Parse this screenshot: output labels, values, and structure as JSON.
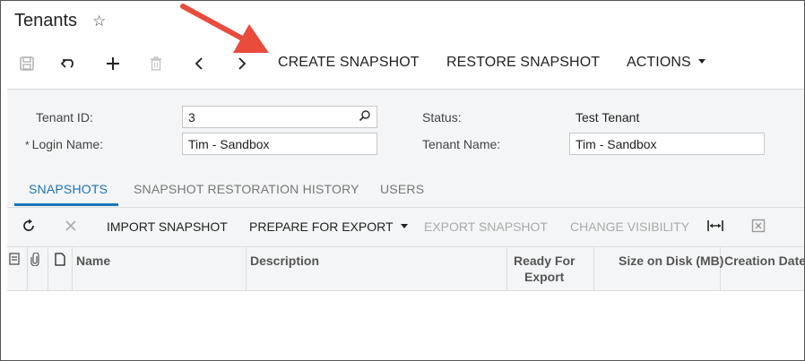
{
  "page": {
    "title": "Tenants"
  },
  "toolbar": {
    "create_snapshot": "CREATE SNAPSHOT",
    "restore_snapshot": "RESTORE SNAPSHOT",
    "actions": "ACTIONS"
  },
  "form": {
    "tenant_id_label": "Tenant ID:",
    "tenant_id_value": "3",
    "login_name_label": "Login Name:",
    "login_name_value": "Tim - Sandbox",
    "required_marker": "*",
    "status_label": "Status:",
    "status_value": "Test Tenant",
    "tenant_name_label": "Tenant Name:",
    "tenant_name_value": "Tim - Sandbox"
  },
  "tabs": [
    {
      "label": "SNAPSHOTS",
      "active": true
    },
    {
      "label": "SNAPSHOT RESTORATION HISTORY",
      "active": false
    },
    {
      "label": "USERS",
      "active": false
    }
  ],
  "grid_toolbar": {
    "import_snapshot": "IMPORT SNAPSHOT",
    "prepare_for_export": "PREPARE FOR EXPORT",
    "export_snapshot": "EXPORT SNAPSHOT",
    "change_visibility": "CHANGE VISIBILITY"
  },
  "grid": {
    "columns": [
      "Name",
      "Description",
      "Ready For",
      "Export",
      "Size on Disk (MB)",
      "Creation Date"
    ],
    "rows": []
  },
  "colors": {
    "accent": "#1a74b8",
    "annotation_arrow": "#e74c3c",
    "panel_bg": "#f4f5f6"
  },
  "icons": [
    "star-icon",
    "save-icon",
    "undo-icon",
    "add-icon",
    "delete-icon",
    "previous-icon",
    "next-icon",
    "search-icon",
    "refresh-icon",
    "close-icon",
    "fit-columns-icon",
    "export-excel-icon",
    "notes-icon",
    "attachment-icon",
    "file-icon"
  ]
}
